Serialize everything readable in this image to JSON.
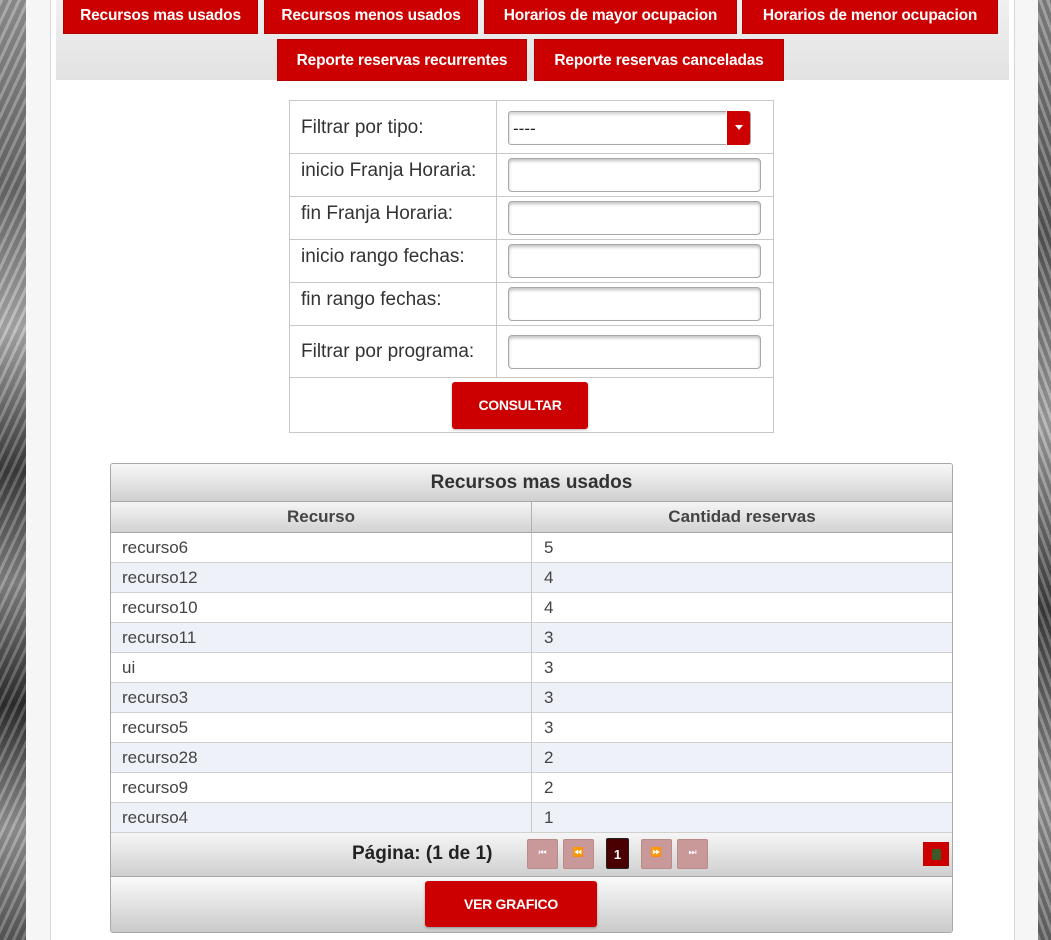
{
  "tabs": {
    "row1": [
      "Recursos mas usados",
      "Recursos menos usados",
      "Horarios de mayor ocupacion",
      "Horarios de menor ocupacion"
    ],
    "row2": [
      "Reporte reservas recurrentes",
      "Reporte reservas canceladas"
    ]
  },
  "filters": {
    "tipo_label": "Filtrar por tipo:",
    "tipo_value": "----",
    "inicio_franja_label": "inicio Franja Horaria:",
    "inicio_franja_value": "",
    "fin_franja_label": "fin Franja Horaria:",
    "fin_franja_value": "",
    "inicio_rango_label": "inicio rango fechas:",
    "inicio_rango_value": "",
    "fin_rango_label": "fin rango fechas:",
    "fin_rango_value": "",
    "programa_label": "Filtrar por programa:",
    "programa_value": "",
    "consultar_label": "CONSULTAR"
  },
  "results": {
    "title": "Recursos mas usados",
    "columns": [
      "Recurso",
      "Cantidad reservas"
    ],
    "rows": [
      [
        "recurso6",
        "5"
      ],
      [
        "recurso12",
        "4"
      ],
      [
        "recurso10",
        "4"
      ],
      [
        "recurso11",
        "3"
      ],
      [
        "ui",
        "3"
      ],
      [
        "recurso3",
        "3"
      ],
      [
        "recurso5",
        "3"
      ],
      [
        "recurso28",
        "2"
      ],
      [
        "recurso9",
        "2"
      ],
      [
        "recurso4",
        "1"
      ]
    ],
    "pager": {
      "label": "Página: (1 de 1)",
      "first_icon": "first-page-icon",
      "prev_icon": "prev-page-icon",
      "current": "1",
      "next_icon": "next-page-icon",
      "last_icon": "last-page-icon",
      "export_icon": "excel-export-icon"
    },
    "ver_grafico_label": "VER GRAFICO"
  },
  "colors": {
    "accent": "#cc0000",
    "pager_disabled": "#c99898",
    "pager_current": "#4a0000"
  }
}
